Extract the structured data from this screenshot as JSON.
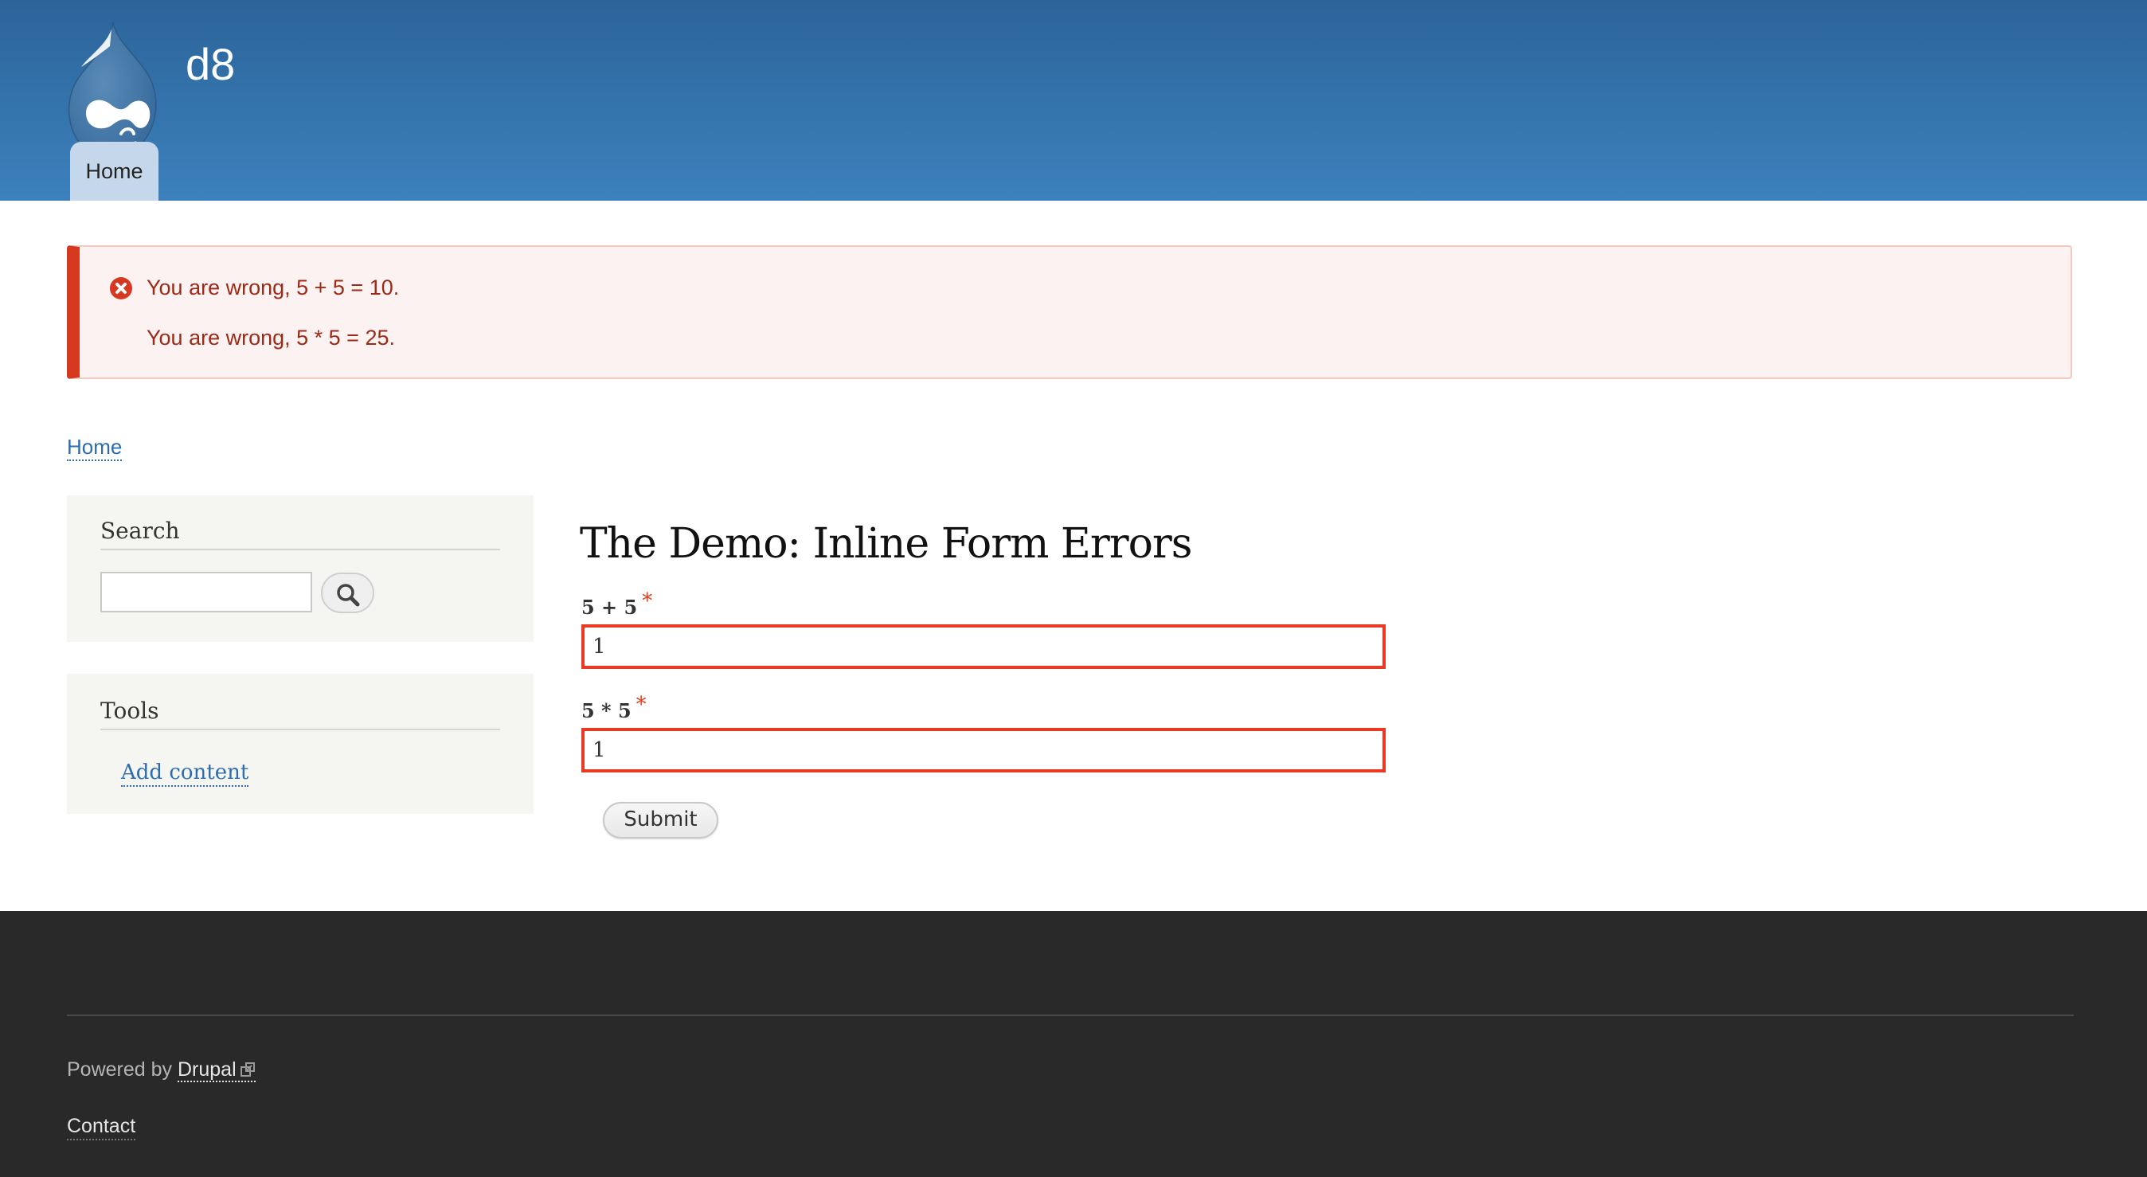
{
  "header": {
    "site_name": "d8",
    "logo": "drupal-drop-logo",
    "nav": [
      {
        "label": "Home",
        "active": true
      }
    ]
  },
  "messages": {
    "type": "error",
    "icon": "error-x-circle-icon",
    "items": [
      "You are wrong, 5 + 5 = 10.",
      "You are wrong, 5 * 5 = 25."
    ]
  },
  "breadcrumb": [
    {
      "label": "Home"
    }
  ],
  "sidebar": {
    "search_block": {
      "title": "Search",
      "input_value": "",
      "button_icon": "magnifier-icon"
    },
    "tools_block": {
      "title": "Tools",
      "links": [
        {
          "label": "Add content"
        }
      ]
    }
  },
  "main": {
    "title": "The Demo: Inline Form Errors",
    "fields": [
      {
        "label": "5 + 5",
        "required_marker": "*",
        "value": "1",
        "error": true
      },
      {
        "label": "5 * 5",
        "required_marker": "*",
        "value": "1",
        "error": true
      }
    ],
    "submit_label": "Submit"
  },
  "footer": {
    "powered_by_prefix": "Powered by",
    "powered_by_link": "Drupal",
    "contact_label": "Contact"
  },
  "colors": {
    "header_top": "#2b6499",
    "header_bottom": "#3c81bd",
    "error_accent": "#d6391f",
    "error_text": "#9d2a17",
    "link": "#2e6cb0",
    "input_error_border": "#e93a25",
    "footer_bg": "#292929"
  }
}
